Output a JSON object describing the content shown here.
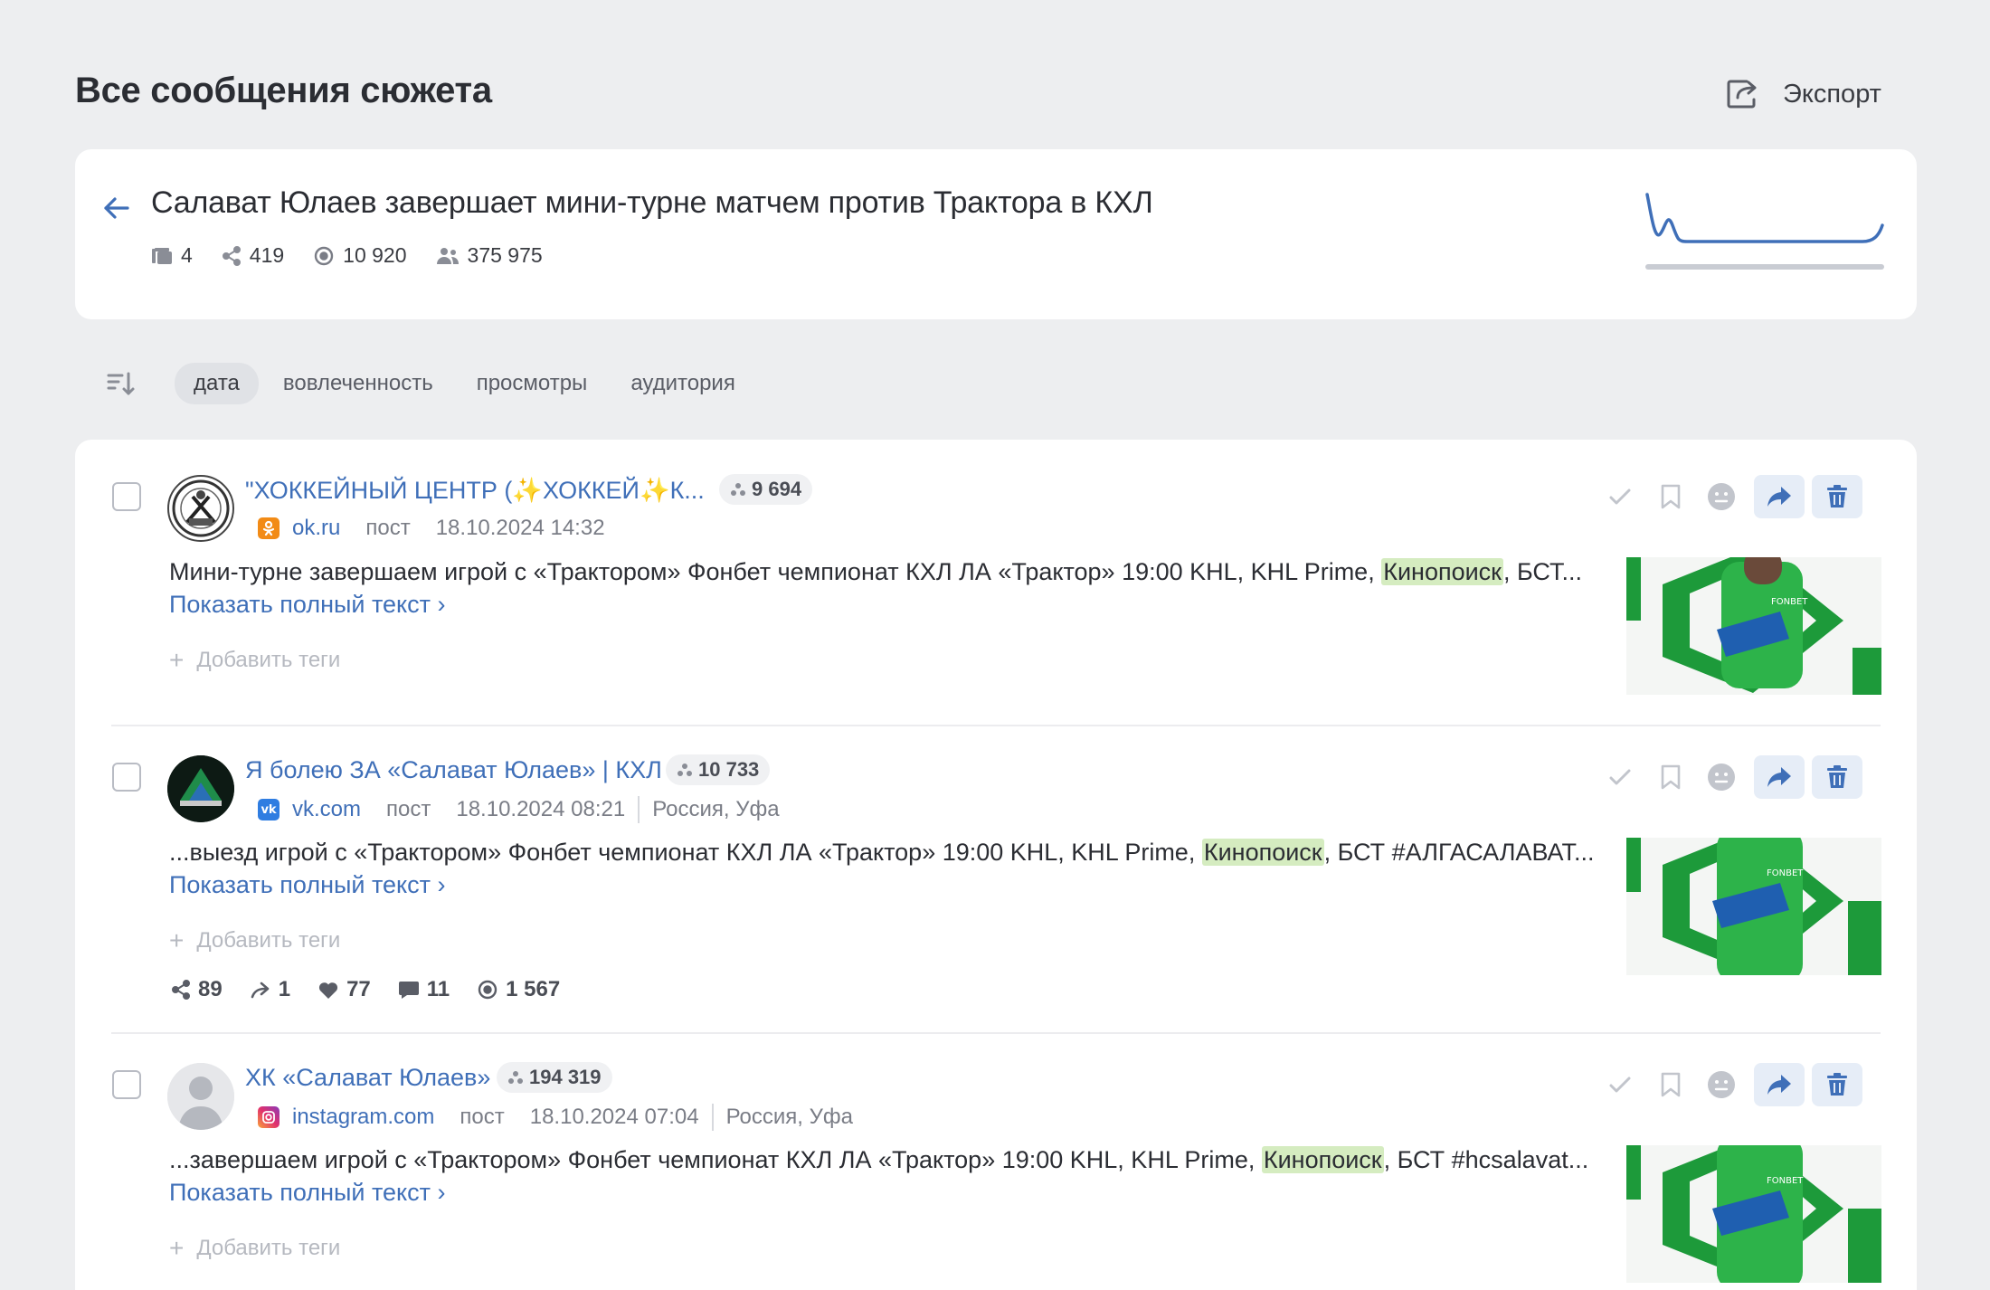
{
  "header": {
    "title": "Все сообщения сюжета",
    "export_label": "Экспорт"
  },
  "story": {
    "title": "Салават Юлаев завершает мини-турне матчем против Трактора в КХЛ",
    "stats": {
      "messages": "4",
      "reposts": "419",
      "views": "10 920",
      "audience": "375 975"
    }
  },
  "sort": {
    "options": [
      "дата",
      "вовлеченность",
      "просмотры",
      "аудитория"
    ],
    "active": "дата"
  },
  "posts": [
    {
      "source": "\"ХОККЕЙНЫЙ ЦЕНТР (✨ХОККЕЙ✨К...",
      "audience": "9 694",
      "site": "ok.ru",
      "site_color": "#f28b16",
      "kind": "пост",
      "datetime": "18.10.2024 14:32",
      "location": "",
      "text_before": "Мини-турне завершаем игрой с «Трактором» Фонбет чемпионат КХЛ ЛА «Трактор» 19:00 KHL, KHL Prime, ",
      "highlight": "Кинопоиск",
      "text_after": ", БСТ...",
      "more": "Показать полный текст",
      "add_tags": "Добавить теги"
    },
    {
      "source": "Я болею ЗА «Салават Юлаев» | КХЛ",
      "audience": "10 733",
      "site": "vk.com",
      "site_color": "#2f7de1",
      "kind": "пост",
      "datetime": "18.10.2024 08:21",
      "location": "Россия, Уфа",
      "text_before": "...выезд игрой с «Трактором» Фонбет чемпионат КХЛ ЛА «Трактор» 19:00 KHL, KHL Prime, ",
      "highlight": "Кинопоиск",
      "text_after": ", БСТ #АЛГАСАЛАВАТ...",
      "more": "Показать полный текст",
      "add_tags": "Добавить теги",
      "metrics": {
        "reposts": "89",
        "shares": "1",
        "likes": "77",
        "comments": "11",
        "views": "1 567"
      }
    },
    {
      "source": "ХК «Салават Юлаев»",
      "audience": "194 319",
      "site": "instagram.com",
      "site_color": "#e1306c",
      "kind": "пост",
      "datetime": "18.10.2024 07:04",
      "location": "Россия, Уфа",
      "text_before": "...завершаем игрой с «Трактором» Фонбет чемпионат КХЛ ЛА «Трактор» 19:00 KHL, KHL Prime, ",
      "highlight": "Кинопоиск",
      "text_after": ", БСТ #hcsalavat...",
      "more": "Показать полный текст",
      "add_tags": "Добавить теги"
    }
  ],
  "colors": {
    "accent": "#3f6fb8",
    "highlight": "#d5ecc0",
    "background": "#edeef0"
  }
}
